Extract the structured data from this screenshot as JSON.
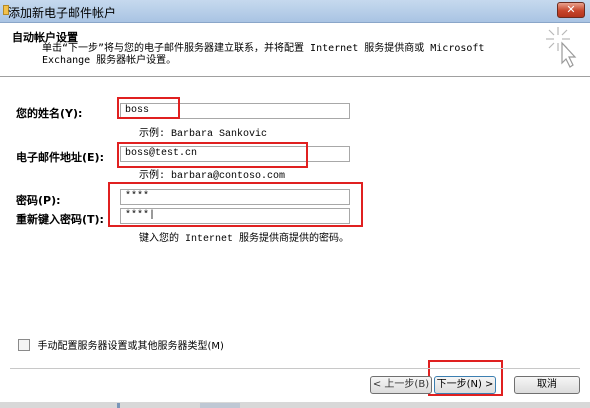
{
  "window": {
    "title": "添加新电子邮件帐户",
    "close_label": "✕"
  },
  "header": {
    "title": "自动帐户设置",
    "description_line1": "单击“下一步”将与您的电子邮件服务器建立联系，并将配置 Internet 服务提供商或 Microsoft",
    "description_line2": "Exchange 服务器帐户设置。"
  },
  "form": {
    "name_label": "您的姓名(Y):",
    "name_value": "boss",
    "name_example": "示例: Barbara Sankovic",
    "email_label": "电子邮件地址(E):",
    "email_value": "boss@test.cn",
    "email_example": "示例: barbara@contoso.com",
    "password_label": "密码(P):",
    "password_value": "****",
    "retype_label": "重新键入密码(T):",
    "retype_value": "****|",
    "password_hint": "键入您的 Internet 服务提供商提供的密码。"
  },
  "manual": {
    "label": "手动配置服务器设置或其他服务器类型(M)",
    "checked": false
  },
  "buttons": {
    "back": "< 上一步(B)",
    "next": "下一步(N) >",
    "cancel": "取消"
  },
  "colors": {
    "highlight": "#e02020",
    "titlebar": "#b7cfe9"
  }
}
